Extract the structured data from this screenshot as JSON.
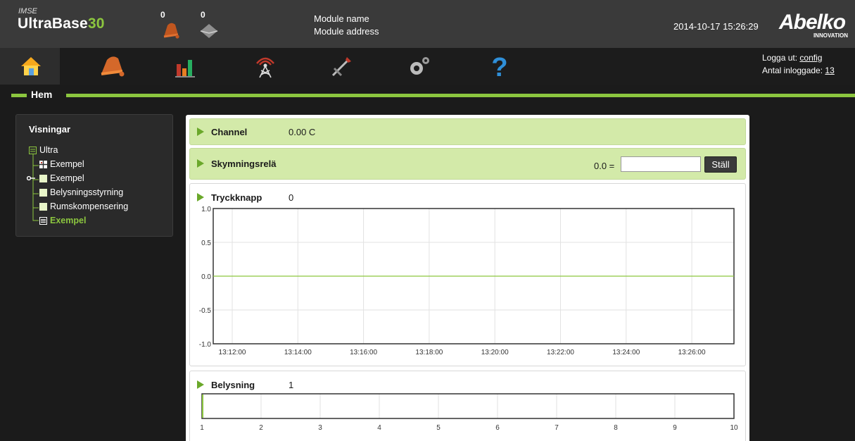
{
  "header": {
    "brand_small": "IMSE",
    "brand_name": "UltraBase",
    "brand_number": "30",
    "alarm_count": "0",
    "message_count": "0",
    "module_name": "Module name",
    "module_address": "Module address",
    "datetime": "2014-10-17 15:26:29",
    "logo_text": "Abelko",
    "logo_sub": "INNOVATION"
  },
  "nav": {
    "items": [
      {
        "icon": "home-icon"
      },
      {
        "icon": "bell-icon"
      },
      {
        "icon": "bar-chart-icon"
      },
      {
        "icon": "antenna-icon"
      },
      {
        "icon": "tools-icon"
      },
      {
        "icon": "gears-icon"
      },
      {
        "icon": "help-icon"
      }
    ],
    "logout_label": "Logga ut:",
    "logout_user": "config",
    "logged_in_label": "Antal inloggade:",
    "logged_in_count": "13"
  },
  "section": {
    "title": "Hem"
  },
  "sidebar": {
    "heading": "Visningar",
    "tree": [
      {
        "label": "Ultra"
      },
      {
        "label": "Exempel"
      },
      {
        "label": "Exempel"
      },
      {
        "label": "Belysningsstyrning"
      },
      {
        "label": "Rumskompensering"
      },
      {
        "label": "Exempel",
        "active": true
      }
    ]
  },
  "panel": {
    "channel": {
      "label": "Channel",
      "value": "0.00 C"
    },
    "relay": {
      "label": "Skymningsrelä",
      "value_prefix": "0.0 =",
      "input_value": "",
      "button_label": "Ställ"
    },
    "tryck": {
      "label": "Tryckknapp",
      "value": "0"
    },
    "belysning": {
      "label": "Belysning",
      "value": "1"
    }
  },
  "colors": {
    "accent": "#8cc63f",
    "header_bg": "#3a3a3a",
    "row_green": "#d3eaa9"
  },
  "chart_data": [
    {
      "type": "line",
      "title": "Tryckknapp",
      "x": [
        "13:12:00",
        "13:14:00",
        "13:16:00",
        "13:18:00",
        "13:20:00",
        "13:22:00",
        "13:24:00",
        "13:26:00"
      ],
      "y_ticks": [
        "1.0",
        "0.5",
        "0.0",
        "-0.5",
        "-1.0"
      ],
      "ylim": [
        -1.0,
        1.0
      ],
      "series": [
        {
          "values": [
            0,
            0,
            0,
            0,
            0,
            0,
            0,
            0
          ],
          "color": "#8cc63f"
        }
      ],
      "grid": true
    },
    {
      "type": "bar",
      "title": "Belysning",
      "x_ticks": [
        "1",
        "2",
        "3",
        "4",
        "5",
        "6",
        "7",
        "8",
        "9",
        "10"
      ],
      "xlim": [
        1,
        10
      ],
      "value": 1,
      "grid": true
    }
  ]
}
